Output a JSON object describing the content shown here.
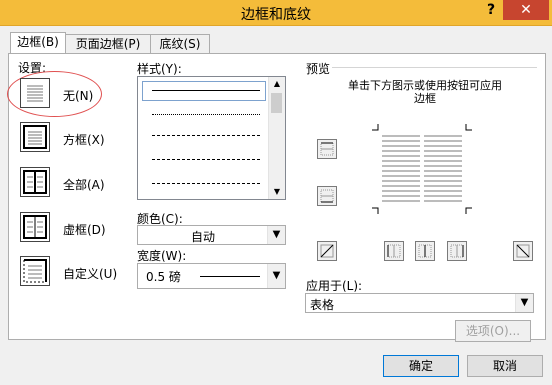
{
  "window": {
    "title": "边框和底纹",
    "help": "?",
    "close": "✕"
  },
  "tabs": [
    {
      "label": "边框(B)"
    },
    {
      "label": "页面边框(P)"
    },
    {
      "label": "底纹(S)"
    }
  ],
  "settings": {
    "heading": "设置:",
    "items": [
      {
        "label": "无(N)"
      },
      {
        "label": "方框(X)"
      },
      {
        "label": "全部(A)"
      },
      {
        "label": "虚框(D)"
      },
      {
        "label": "自定义(U)"
      }
    ]
  },
  "style": {
    "label": "样式(Y):"
  },
  "color": {
    "label": "颜色(C):",
    "value": "自动"
  },
  "width": {
    "label": "宽度(W):",
    "value": "0.5 磅"
  },
  "preview": {
    "heading": "预览",
    "instruction": "单击下方图示或使用按钮可应用边框"
  },
  "apply_to": {
    "label": "应用于(L):",
    "value": "表格"
  },
  "options_button": "选项(O)...",
  "ok_button": "确定",
  "cancel_button": "取消"
}
